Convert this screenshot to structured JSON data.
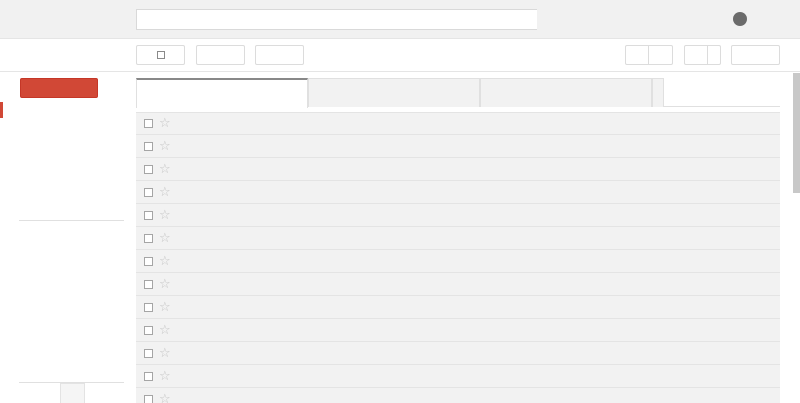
{
  "header": {
    "search": {
      "value": "",
      "placeholder": ""
    },
    "account_icon": "account-avatar-icon"
  },
  "toolbar": {
    "select_icon": "checkbox-icon",
    "buttons": [
      "",
      "",
      "",
      "",
      "",
      "",
      ""
    ]
  },
  "sidebar": {
    "compose_label": "",
    "accent_color": "#d14836"
  },
  "tabs": [
    {
      "label": ""
    },
    {
      "label": ""
    },
    {
      "label": ""
    }
  ],
  "messages": [
    {
      "sender": "",
      "subject": ""
    },
    {
      "sender": "",
      "subject": ""
    },
    {
      "sender": "",
      "subject": ""
    },
    {
      "sender": "",
      "subject": ""
    },
    {
      "sender": "",
      "subject": ""
    },
    {
      "sender": "",
      "subject": ""
    },
    {
      "sender": "",
      "subject": ""
    },
    {
      "sender": "",
      "subject": ""
    },
    {
      "sender": "",
      "subject": ""
    },
    {
      "sender": "",
      "subject": ""
    },
    {
      "sender": "",
      "subject": ""
    },
    {
      "sender": "",
      "subject": ""
    },
    {
      "sender": "",
      "subject": ""
    }
  ],
  "icons": {
    "row_checkbox": "checkbox-icon",
    "row_star": "star-outline-icon",
    "star_glyph": "☆"
  }
}
